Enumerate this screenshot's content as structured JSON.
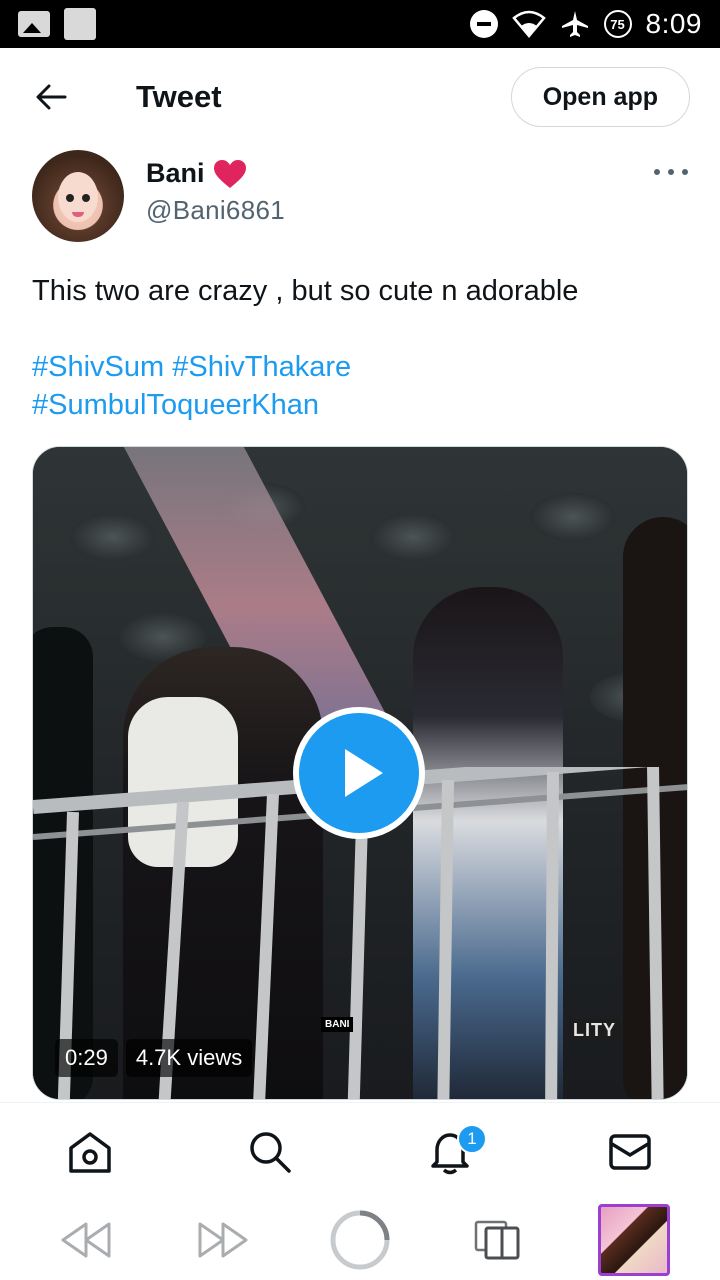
{
  "status_bar": {
    "time": "8:09",
    "battery_badge": "75"
  },
  "header": {
    "title": "Tweet",
    "open_app_label": "Open app"
  },
  "author": {
    "display_name": "Bani",
    "handle": "@Bani6861"
  },
  "tweet": {
    "text": "This two are crazy , but so cute n adorable",
    "hashtags": [
      "#ShivSum",
      "#ShivThakare",
      "#SumbulToqueerKhan"
    ]
  },
  "video": {
    "duration": "0:29",
    "views": "4.7K views",
    "watermark": "BANI",
    "overlay_text": "LITY"
  },
  "tab_bar": {
    "items": [
      {
        "name": "home",
        "icon": "home-icon"
      },
      {
        "name": "search",
        "icon": "search-icon"
      },
      {
        "name": "notifications",
        "icon": "bell-icon",
        "badge": "1"
      },
      {
        "name": "messages",
        "icon": "mail-icon"
      }
    ]
  },
  "colors": {
    "accent": "#1d9bf0",
    "text": "#0f1419",
    "secondary": "#536471",
    "heart": "#e0245e"
  }
}
